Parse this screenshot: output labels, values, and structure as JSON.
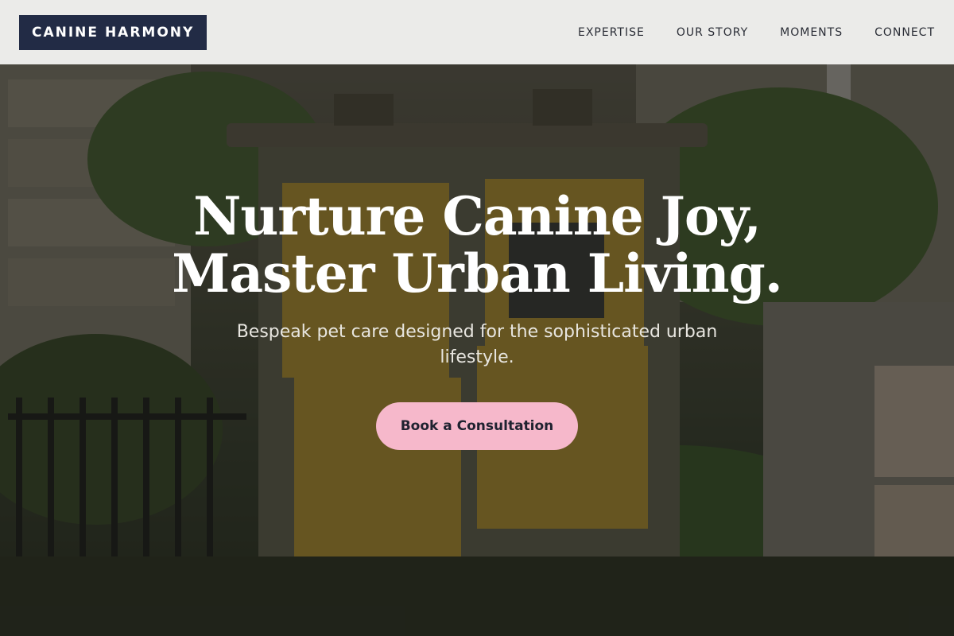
{
  "brand": {
    "logo_text": "CANINE HARMONY"
  },
  "nav": {
    "items": [
      {
        "label": "EXPERTISE"
      },
      {
        "label": "OUR STORY"
      },
      {
        "label": "MOMENTS"
      },
      {
        "label": "CONNECT"
      }
    ]
  },
  "hero": {
    "headline_line1": "Nurture Canine Joy,",
    "headline_line2": "Master Urban Living.",
    "subtitle": "Bespeak pet care designed for the sophisticated urban lifestyle.",
    "cta_label": "Book a Consultation",
    "background_description_icon": "street-utility-box-photo"
  },
  "colors": {
    "header_bg": "#f2f2f0",
    "logo_bg": "#222b45",
    "logo_text": "#ffffff",
    "nav_text": "#2a2d36",
    "cta_bg": "#f6b8cb",
    "cta_text": "#1f2230",
    "headline_text": "#ffffff"
  }
}
